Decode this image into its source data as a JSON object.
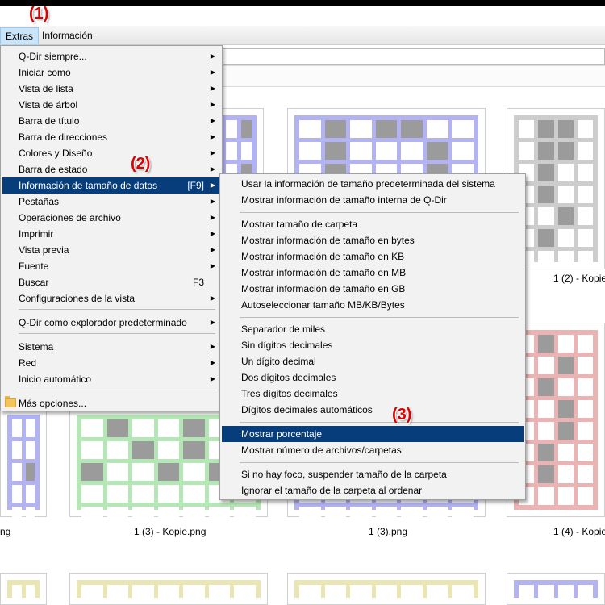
{
  "annotations": [
    "(1)",
    "(2)",
    "(3)"
  ],
  "menubar": {
    "extras": "Extras",
    "info": "Información"
  },
  "main_menu": {
    "items": [
      {
        "label": "Q-Dir siempre...",
        "submenu": true
      },
      {
        "label": "Iniciar como",
        "submenu": true
      },
      {
        "label": "Vista de lista",
        "submenu": true
      },
      {
        "label": "Vista de árbol",
        "submenu": true
      },
      {
        "label": "Barra de título",
        "submenu": true
      },
      {
        "label": "Barra de direcciones",
        "submenu": true
      },
      {
        "label": "Colores y Diseño",
        "submenu": true
      },
      {
        "label": "Barra de estado",
        "submenu": true
      },
      {
        "label": "Información de tamaño de datos",
        "shortcut": "[F9]",
        "submenu": true
      },
      {
        "label": "Pestañas",
        "submenu": true
      },
      {
        "label": "Operaciones de archivo",
        "submenu": true
      },
      {
        "label": "Imprimir",
        "submenu": true
      },
      {
        "label": "Vista previa",
        "submenu": true
      },
      {
        "label": "Fuente",
        "submenu": true
      },
      {
        "label": "Buscar",
        "shortcut": "F3"
      },
      {
        "label": "Configuraciones de la vista",
        "submenu": true
      },
      {
        "label": "Q-Dir como explorador predeterminado",
        "submenu": true
      },
      {
        "label": "Sistema",
        "submenu": true
      },
      {
        "label": "Red",
        "submenu": true
      },
      {
        "label": "Inicio automático",
        "submenu": true
      },
      {
        "label": "Más opciones..."
      }
    ]
  },
  "sub_menu": {
    "items": [
      {
        "label": "Usar la información de tamaño predeterminada del sistema"
      },
      {
        "label": "Mostrar información de tamaño interna de Q-Dir"
      },
      {
        "label": "Mostrar tamaño de carpeta"
      },
      {
        "label": "Mostrar información de tamaño en bytes"
      },
      {
        "label": "Mostrar información de tamaño en KB"
      },
      {
        "label": "Mostrar información de tamaño en MB"
      },
      {
        "label": "Mostrar información de tamaño en GB"
      },
      {
        "label": "Autoseleccionar tamaño MB/KB/Bytes"
      },
      {
        "label": "Separador de miles"
      },
      {
        "label": "Sin dígitos decimales"
      },
      {
        "label": "Un dígito decimal"
      },
      {
        "label": "Dos dígitos decimales"
      },
      {
        "label": "Tres dígitos decimales"
      },
      {
        "label": "Dígitos decimales automáticos"
      },
      {
        "label": "Mostrar porcentaje"
      },
      {
        "label": "Mostrar número de archivos/carpetas"
      },
      {
        "label": "Si no hay foco, suspender tamaño de la carpeta"
      },
      {
        "label": "Ignorar el tamaño de la carpeta al ordenar"
      }
    ]
  },
  "files": [
    {
      "caption": "1 (2) - Kopie"
    },
    {
      "caption": "ng"
    },
    {
      "caption": "1 (3) - Kopie.png"
    },
    {
      "caption": "1 (3).png"
    },
    {
      "caption": "1 (4) - Kopie"
    }
  ],
  "colors": {
    "menu_highlight": "#063d7a",
    "annotation": "#e00000",
    "thumb_blue": "#b3b3f2",
    "thumb_gray": "#cdcdcd",
    "thumb_green": "#b5e6b5",
    "thumb_red": "#eab4b4",
    "thumb_yellow": "#e9e6b4"
  }
}
